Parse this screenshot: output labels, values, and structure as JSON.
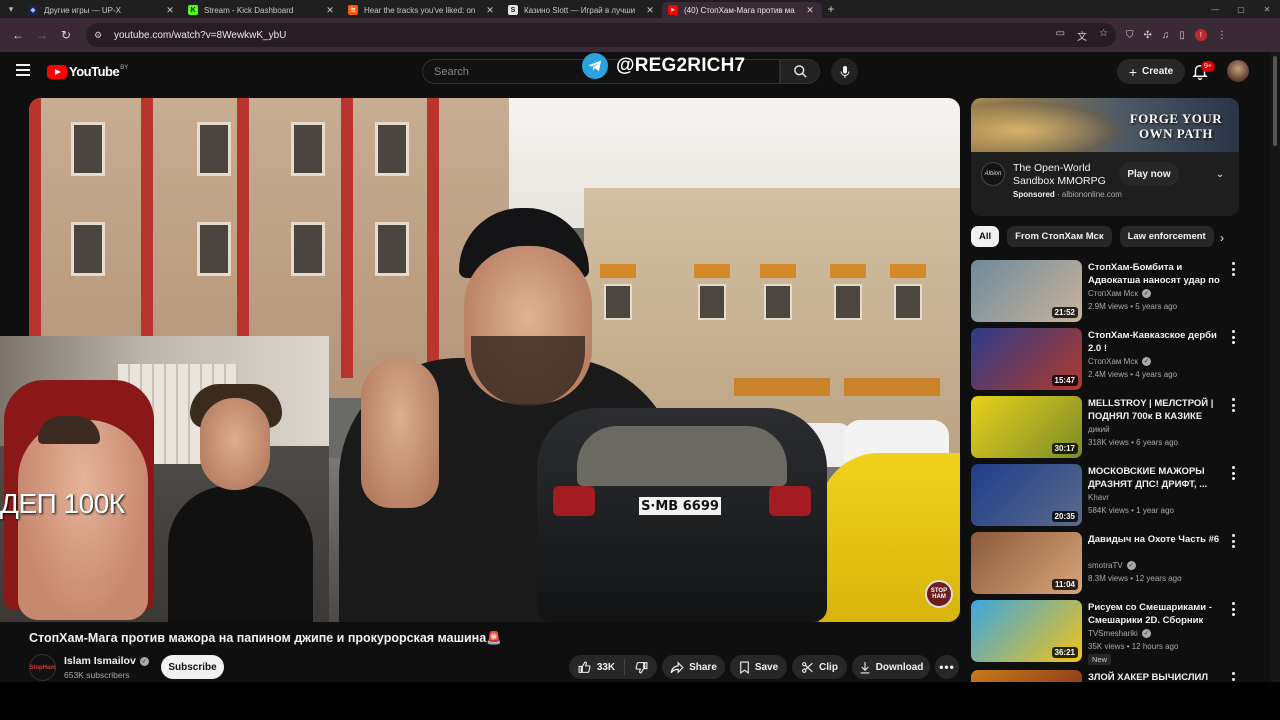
{
  "browser": {
    "tabs": [
      {
        "title": "Другие игры — UP-X",
        "icon_color": "#1a2240",
        "active": false
      },
      {
        "title": "Stream - Kick Dashboard",
        "icon_color": "#53fc18",
        "icon_letter": "K",
        "active": false
      },
      {
        "title": "Hear the tracks you've liked: on",
        "icon_color": "#ff5500",
        "active": false
      },
      {
        "title": "Казино Slott — Играй в лучши",
        "icon_color": "#e8e8e8",
        "icon_letter": "S",
        "active": false
      },
      {
        "title": "(40) СтопХам-Мага против ма",
        "icon_color": "#ff0000",
        "active": true
      }
    ],
    "url": "youtube.com/watch?v=8WewkwK_ybU"
  },
  "youtube": {
    "logo_text": "YouTube",
    "country_code": "BY",
    "search_placeholder": "Search",
    "overlay_watermark": "@REG2RICH7",
    "create_label": "Create",
    "notification_count": "9+"
  },
  "player": {
    "overlay_text": "ДЕП 100К",
    "plate_text": "S·MB 6699",
    "corner_badge": "STOP HAM"
  },
  "video": {
    "title": "СтопХам-Мага против мажора на папином джипе и прокурорская машина🚨",
    "channel_name": "Islam Ismailov",
    "subscribers": "653K subscribers",
    "subscribe_label": "Subscribe",
    "likes": "33K",
    "share_label": "Share",
    "save_label": "Save",
    "clip_label": "Clip",
    "download_label": "Download"
  },
  "ad": {
    "headline": "FORGE YOUR OWN PATH",
    "title": "The Open-World Sandbox MMORPG",
    "sponsored_label": "Sponsored",
    "domain": "albiononline.com",
    "logo_text": "Albion",
    "cta": "Play now"
  },
  "chips": [
    "All",
    "From СтопХам Мск",
    "Law enforcement"
  ],
  "recommendations": [
    {
      "title": "СтопХам-Бомбита и Адвокатша наносят удар по ...",
      "channel": "СтопХам Мск",
      "verified": true,
      "views": "2.9M views",
      "age": "5 years ago",
      "duration": "21:52",
      "thumb_colors": [
        "#6f8a9a",
        "#c9b49e"
      ]
    },
    {
      "title": "СтопХам-Кавказское дерби 2.0 !",
      "channel": "СтопХам Мск",
      "verified": true,
      "views": "2.4M views",
      "age": "4 years ago",
      "duration": "15:47",
      "thumb_colors": [
        "#2b3b8a",
        "#b23a2a"
      ]
    },
    {
      "title": "MELLSTROY | МЕЛСТРОЙ | ПОДНЯЛ 700к В КАЗИКЕ",
      "channel": "дикий",
      "verified": false,
      "views": "318K views",
      "age": "6 years ago",
      "duration": "30:17",
      "thumb_colors": [
        "#e8d21a",
        "#7a8b2a"
      ]
    },
    {
      "title": "МОСКОВСКИЕ МАЖОРЫ ДРАЗНЯТ ДПС! ДРИФТ, ...",
      "channel": "Khavr",
      "verified": false,
      "views": "584K views",
      "age": "1 year ago",
      "duration": "20:35",
      "thumb_colors": [
        "#1f3d8a",
        "#5a6a8a"
      ]
    },
    {
      "title": "Давидыч на Охоте Часть #6",
      "channel": "smotraTV",
      "verified": true,
      "views": "8.3M views",
      "age": "12 years ago",
      "duration": "11:04",
      "thumb_colors": [
        "#8a5a3a",
        "#d9a57a"
      ]
    },
    {
      "title": "Рисуем со Смешариками - Смешарики 2D. Сборник 2026",
      "channel": "TVSmeshariki",
      "verified": true,
      "views": "35K views",
      "age": "12 hours ago",
      "duration": "36:21",
      "new_label": "New",
      "thumb_colors": [
        "#3aa7e0",
        "#f5c21a"
      ]
    },
    {
      "title": "ЗЛОЙ ХАКЕР ВЫЧИСЛИЛ",
      "channel": "",
      "verified": false,
      "views": "",
      "age": "",
      "duration": "",
      "thumb_colors": [
        "#c97a1a",
        "#7a2a1a"
      ]
    }
  ]
}
